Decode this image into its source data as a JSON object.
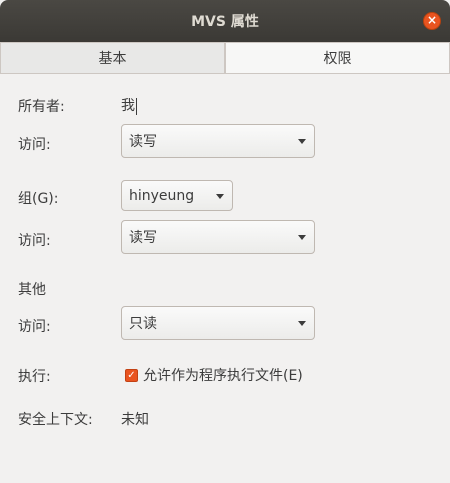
{
  "window": {
    "title": "MVS 属性",
    "close_icon": "×"
  },
  "tabs": [
    {
      "label": "基本",
      "active": false
    },
    {
      "label": "权限",
      "active": true
    }
  ],
  "owner": {
    "label": "所有者:",
    "value": "我"
  },
  "owner_access": {
    "label": "访问:",
    "selected": "读写"
  },
  "group": {
    "label": "组(G):",
    "selected": "hinyeung"
  },
  "group_access": {
    "label": "访问:",
    "selected": "读写"
  },
  "others": {
    "heading": "其他"
  },
  "others_access": {
    "label": "访问:",
    "selected": "只读"
  },
  "execute": {
    "label": "执行:",
    "checkbox_label": "允许作为程序执行文件(E)",
    "checked": true,
    "check_glyph": "✓"
  },
  "security_context": {
    "label": "安全上下文:",
    "value": "未知"
  },
  "colors": {
    "accent": "#e95420",
    "titlebar": "#3b3935",
    "background": "#f2f1f0"
  }
}
